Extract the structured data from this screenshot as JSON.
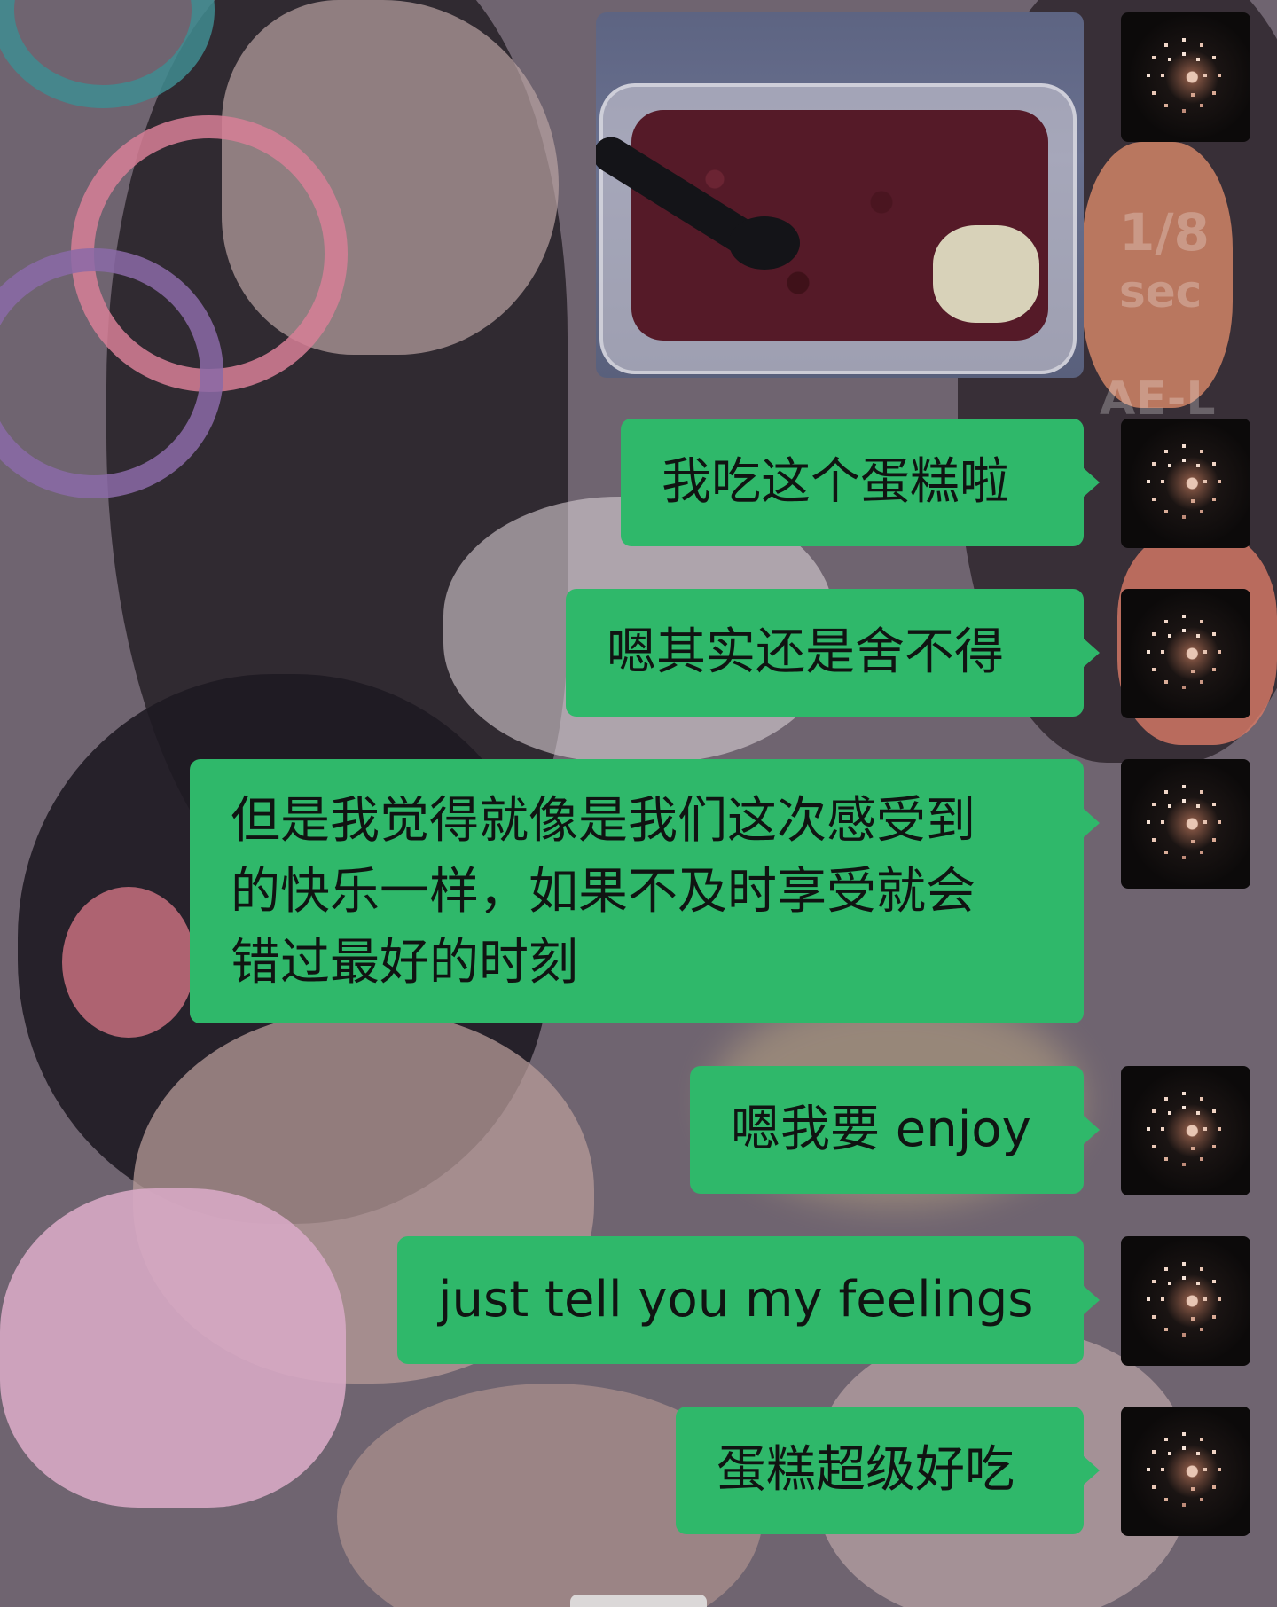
{
  "chat": {
    "image_message": {
      "alt": "cake in a plastic container with a black spoon"
    },
    "messages": [
      {
        "text": "我吃这个蛋糕啦"
      },
      {
        "text": "嗯其实还是舍不得"
      },
      {
        "text": "但是我觉得就像是我们这次感受到\n的快乐一样，如果不及时享受就会\n错过最好的时刻"
      },
      {
        "text": "嗯我要 enjoy"
      },
      {
        "text": "just tell you my feelings"
      },
      {
        "text": "蛋糕超级好吃"
      }
    ]
  },
  "background_overlay": {
    "top": "1/8",
    "middle": "sec",
    "bottom": "AE-L"
  },
  "colors": {
    "bubble": "#2fb86a",
    "bubble_text": "#101412",
    "background": "#6f6470"
  },
  "icons": {
    "avatar": "fireworks-avatar-icon"
  }
}
